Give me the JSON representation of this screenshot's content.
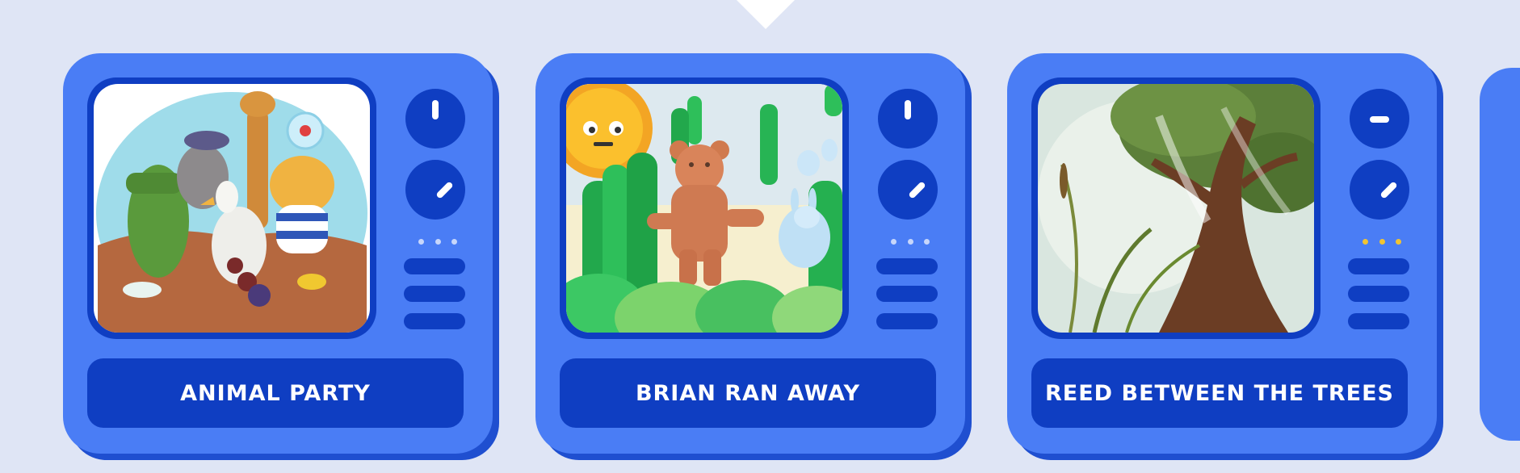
{
  "stories": [
    {
      "title": "ANIMAL PARTY",
      "illustration": "animal-party-illustration"
    },
    {
      "title": "BRIAN RAN AWAY",
      "illustration": "brian-ran-away-illustration"
    },
    {
      "title": "REED BETWEEN THE TREES",
      "illustration": "reed-between-the-trees-illustration"
    }
  ],
  "colors": {
    "background": "#dfe5f5",
    "card": "#4a7df5",
    "card_shadow": "#1f4fd0",
    "dark_blue": "#0f3ec2",
    "active_dot": "#f2c431"
  }
}
